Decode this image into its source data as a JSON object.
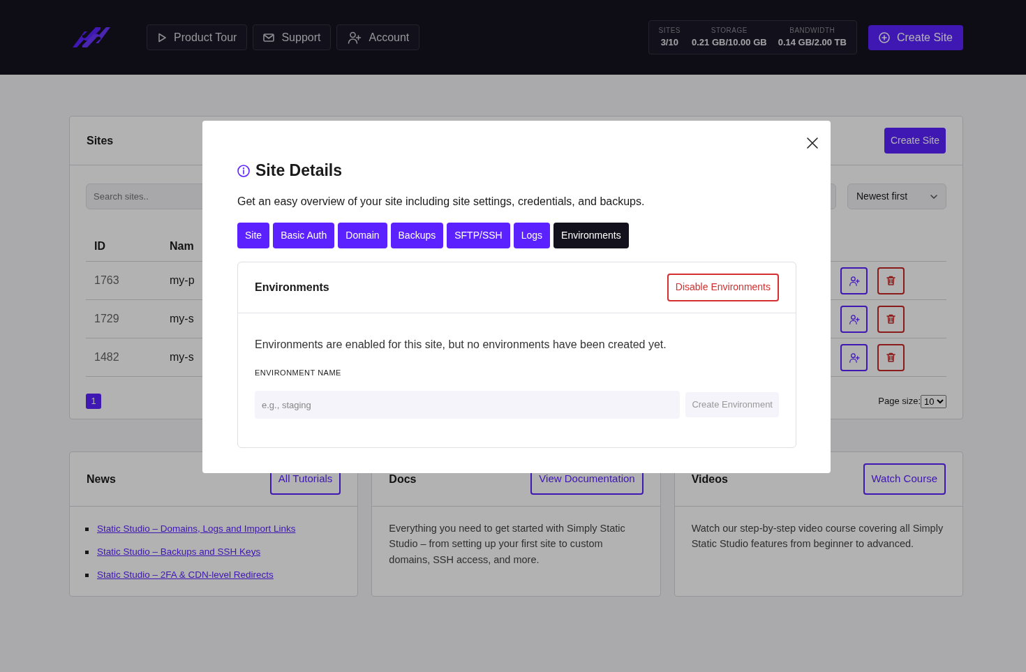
{
  "header": {
    "nav_buttons": [
      {
        "label": "Product Tour",
        "kind": "tour"
      },
      {
        "label": "Support",
        "kind": "support"
      },
      {
        "label": "Account",
        "kind": "account"
      }
    ],
    "usage": [
      {
        "label": "SITES",
        "value": "3/10"
      },
      {
        "label": "STORAGE",
        "value": "0.21 GB/10.00 GB"
      },
      {
        "label": "BANDWIDTH",
        "value": "0.14 GB/2.00 TB"
      }
    ],
    "create_button": "Create Site"
  },
  "sites": {
    "title": "Sites",
    "create_button": "Create Site",
    "search": {
      "placeholder": "Search sites.."
    },
    "sort": "Newest first",
    "columns": [
      "ID",
      "Nam"
    ],
    "rows": [
      {
        "id": "1763",
        "name": "my-p"
      },
      {
        "id": "1729",
        "name": "my-s"
      },
      {
        "id": "1482",
        "name": "my-s"
      }
    ],
    "pages": [
      {
        "label": "1",
        "selected": true
      }
    ],
    "page_size_label": "Page size:",
    "page_size": "10"
  },
  "modal": {
    "title": "Site Details",
    "description": "Get an easy overview of your site including site settings, credentials, and backups.",
    "tabs": [
      {
        "label": "Site",
        "selected": false
      },
      {
        "label": "Basic Auth",
        "selected": false
      },
      {
        "label": "Domain",
        "selected": false
      },
      {
        "label": "Backups",
        "selected": false
      },
      {
        "label": "SFTP/SSH",
        "selected": false
      },
      {
        "label": "Logs",
        "selected": false
      },
      {
        "label": "Environments",
        "selected": true
      }
    ],
    "panel": {
      "title": "Environments",
      "action_button": "Disable Environments",
      "message": "Environments are enabled for this site, but no environments have been created yet.",
      "field_label": "ENVIRONMENT NAME",
      "placeholder": "e.g., staging",
      "submit_button": "Create Environment",
      "submit_disabled": true
    }
  },
  "cards": [
    {
      "kind": "links",
      "title": "News",
      "button": "All Tutorials",
      "links": [
        "Static Studio – Domains, Logs and Import Links",
        "Static Studio – Backups and SSH Keys",
        "Static Studio – 2FA & CDN-level Redirects"
      ]
    },
    {
      "kind": "text",
      "title": "Docs",
      "button": "View Documentation",
      "text": "Everything you need to get started with Simply Static Studio – from setting up your first site to custom domains, SSH access, and more."
    },
    {
      "kind": "text",
      "title": "Videos",
      "button": "Watch Course",
      "text": "Watch our step-by-step video course covering all Simply Static Studio features from beginner to advanced."
    }
  ]
}
